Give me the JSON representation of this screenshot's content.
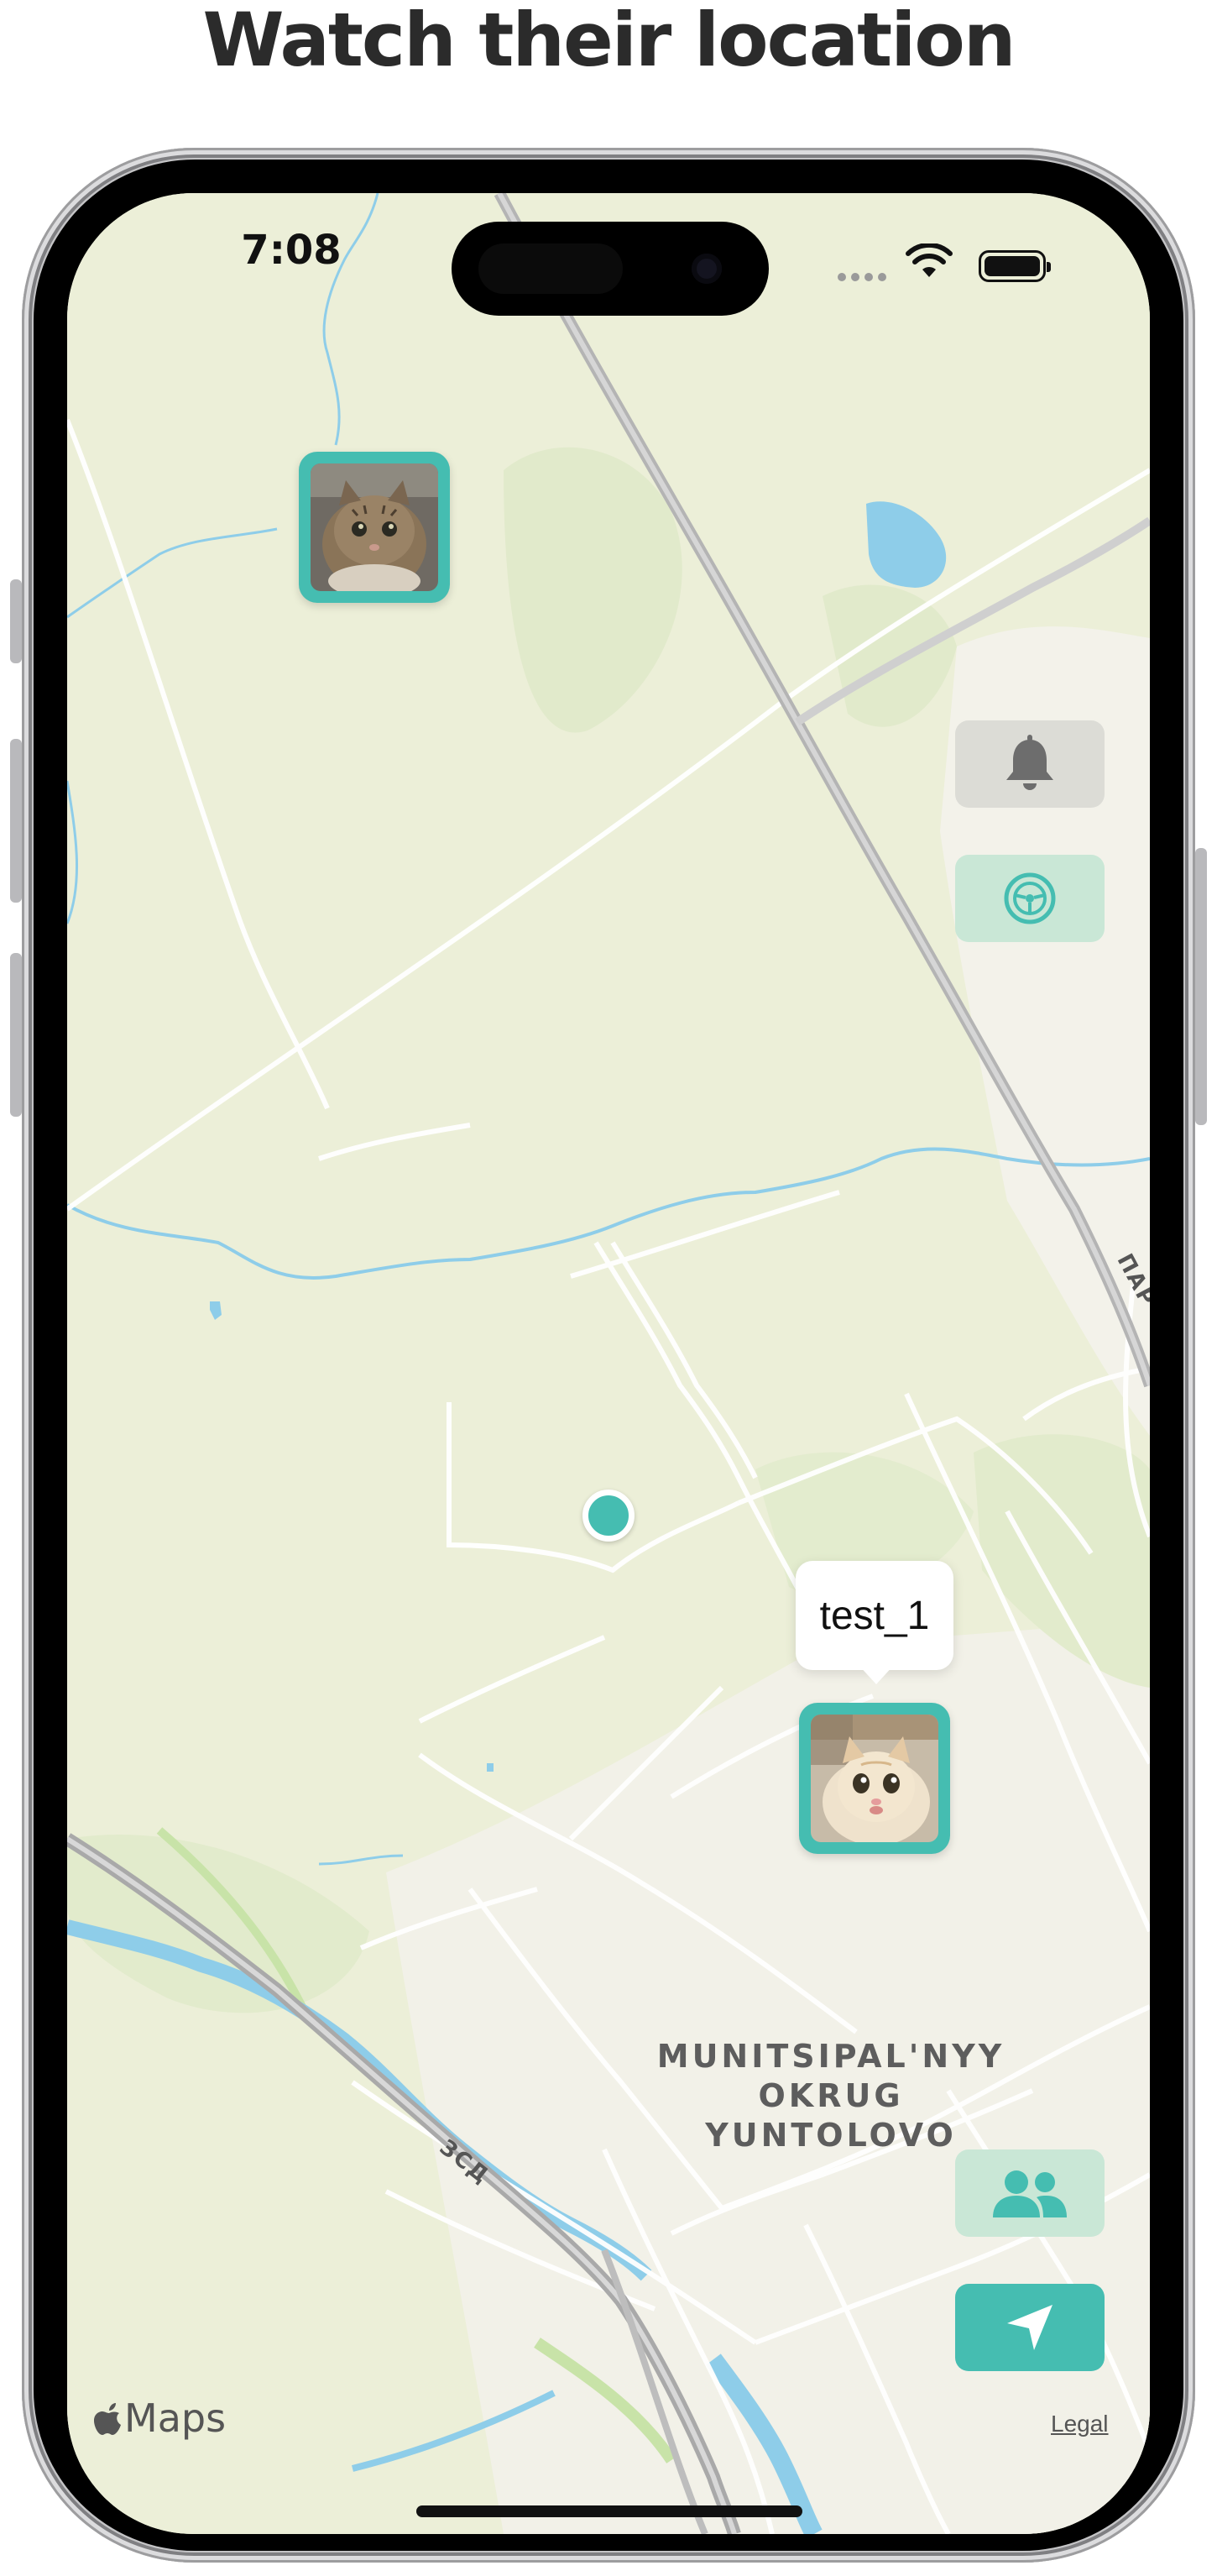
{
  "headline": "Watch their location",
  "status_bar": {
    "time": "7:08"
  },
  "map": {
    "district_label_lines": [
      "MUNITSIPAL'NYY",
      "OKRUG",
      "YUNTOLOVO"
    ],
    "road_labels": [
      "ЗСД",
      "ПАР"
    ],
    "attribution": "Maps",
    "legal": "Legal"
  },
  "markers": [
    {
      "name": "",
      "avatar": "cat-tabby-photo"
    },
    {
      "name": "test_1",
      "avatar": "cat-cream-photo"
    }
  ],
  "controls": [
    {
      "icon": "bell-icon",
      "colors": {
        "bg": "#dcdcd6",
        "fg": "#6d6d6d"
      }
    },
    {
      "icon": "steering-wheel-icon",
      "colors": {
        "bg": "#c9e7d6",
        "fg": "#45bdb1"
      }
    },
    {
      "icon": "people-icon",
      "colors": {
        "bg": "#c9e7d6",
        "fg": "#45bdb1"
      }
    },
    {
      "icon": "location-arrow-icon",
      "colors": {
        "bg": "#45bdb1",
        "fg": "#ffffff"
      }
    }
  ],
  "colors": {
    "accent": "#45bdb1",
    "map_land": "#ecefd8",
    "water": "#8ecde9"
  }
}
